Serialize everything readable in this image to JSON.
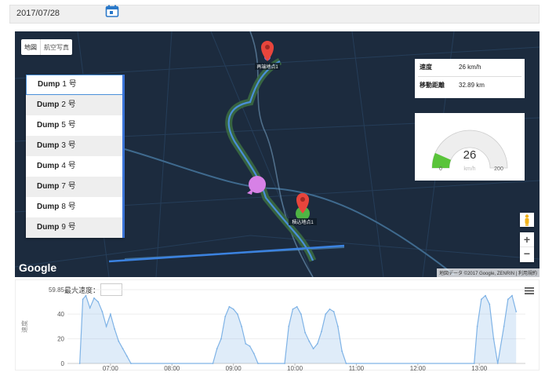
{
  "date": {
    "value": "2017/07/28"
  },
  "map": {
    "tabs": [
      "地図",
      "航空写真"
    ],
    "dump_list": [
      {
        "name": "Dump",
        "num": "1 号",
        "selected": true
      },
      {
        "name": "Dump",
        "num": "2 号"
      },
      {
        "name": "Dump",
        "num": "5 号"
      },
      {
        "name": "Dump",
        "num": "3 号"
      },
      {
        "name": "Dump",
        "num": "4 号"
      },
      {
        "name": "Dump",
        "num": "7 号"
      },
      {
        "name": "Dump",
        "num": "8 号"
      },
      {
        "name": "Dump",
        "num": "9 号"
      }
    ],
    "info": {
      "speed_label": "速度",
      "speed_value": "26 km/h",
      "distance_label": "移動距離",
      "distance_value": "32.89 km"
    },
    "gauge": {
      "value": "26",
      "min": "0",
      "max": "200",
      "unit": "km/h",
      "fraction": 0.13,
      "fill_color": "#5ac43a"
    },
    "markers": {
      "top_label": "再端地点1",
      "bottom_label": "積込地点1"
    },
    "google": "Google",
    "attribution": "地図データ ©2017 Google, ZENRIN | 利用規約",
    "zoom_in": "+",
    "zoom_out": "−"
  },
  "chart_data": {
    "type": "area",
    "ylabel": "速度",
    "yticks": [
      "59.85",
      "40",
      "20",
      "0"
    ],
    "ylim": [
      0,
      59.85
    ],
    "xticks": [
      "07:00",
      "08:00",
      "09:00",
      "10:00",
      "11:00",
      "12:00",
      "13:00"
    ],
    "max_speed_label": "最大速度：",
    "series_color": "#7fb3e6",
    "series": [
      {
        "values": [
          {
            "x": "06:30",
            "y": 0
          },
          {
            "x": "06:33",
            "y": 52
          },
          {
            "x": "06:36",
            "y": 55
          },
          {
            "x": "06:40",
            "y": 45
          },
          {
            "x": "06:44",
            "y": 53
          },
          {
            "x": "06:48",
            "y": 50
          },
          {
            "x": "06:52",
            "y": 42
          },
          {
            "x": "06:56",
            "y": 30
          },
          {
            "x": "07:00",
            "y": 40
          },
          {
            "x": "07:04",
            "y": 28
          },
          {
            "x": "07:08",
            "y": 18
          },
          {
            "x": "07:12",
            "y": 12
          },
          {
            "x": "07:16",
            "y": 6
          },
          {
            "x": "07:20",
            "y": 0
          },
          {
            "x": "08:40",
            "y": 0
          },
          {
            "x": "08:44",
            "y": 12
          },
          {
            "x": "08:48",
            "y": 20
          },
          {
            "x": "08:52",
            "y": 38
          },
          {
            "x": "08:56",
            "y": 46
          },
          {
            "x": "09:00",
            "y": 44
          },
          {
            "x": "09:04",
            "y": 40
          },
          {
            "x": "09:08",
            "y": 30
          },
          {
            "x": "09:12",
            "y": 16
          },
          {
            "x": "09:16",
            "y": 14
          },
          {
            "x": "09:20",
            "y": 8
          },
          {
            "x": "09:24",
            "y": 0
          },
          {
            "x": "09:50",
            "y": 0
          },
          {
            "x": "09:54",
            "y": 30
          },
          {
            "x": "09:58",
            "y": 44
          },
          {
            "x": "10:02",
            "y": 46
          },
          {
            "x": "10:06",
            "y": 40
          },
          {
            "x": "10:10",
            "y": 25
          },
          {
            "x": "10:14",
            "y": 18
          },
          {
            "x": "10:18",
            "y": 12
          },
          {
            "x": "10:22",
            "y": 16
          },
          {
            "x": "10:26",
            "y": 26
          },
          {
            "x": "10:30",
            "y": 40
          },
          {
            "x": "10:34",
            "y": 44
          },
          {
            "x": "10:38",
            "y": 42
          },
          {
            "x": "10:42",
            "y": 30
          },
          {
            "x": "10:46",
            "y": 10
          },
          {
            "x": "10:50",
            "y": 0
          },
          {
            "x": "12:55",
            "y": 0
          },
          {
            "x": "12:58",
            "y": 30
          },
          {
            "x": "13:02",
            "y": 52
          },
          {
            "x": "13:06",
            "y": 55
          },
          {
            "x": "13:10",
            "y": 48
          },
          {
            "x": "13:14",
            "y": 20
          },
          {
            "x": "13:18",
            "y": 0
          },
          {
            "x": "13:24",
            "y": 30
          },
          {
            "x": "13:28",
            "y": 52
          },
          {
            "x": "13:32",
            "y": 55
          },
          {
            "x": "13:36",
            "y": 42
          }
        ]
      }
    ]
  }
}
